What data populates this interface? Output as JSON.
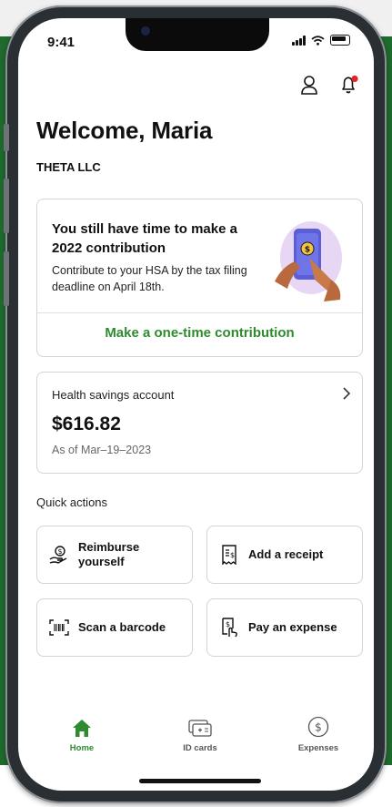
{
  "status_bar": {
    "time": "9:41"
  },
  "header": {
    "greeting": "Welcome, Maria",
    "company": "THETA LLC"
  },
  "promo": {
    "title": "You still have time to make a 2022 contribution",
    "text": "Contribute to your HSA by the tax filing deadline on April 18th.",
    "link": "Make a one-time contribution"
  },
  "account": {
    "label": "Health savings account",
    "amount": "$616.82",
    "as_of": "As of Mar–19–2023"
  },
  "quick_actions": {
    "title": "Quick actions",
    "items": [
      {
        "label": "Reimburse yourself",
        "icon": "reimburse-hand-coin-icon"
      },
      {
        "label": "Add a receipt",
        "icon": "receipt-icon"
      },
      {
        "label": "Scan a barcode",
        "icon": "barcode-scan-icon"
      },
      {
        "label": "Pay an expense",
        "icon": "pay-expense-icon"
      }
    ]
  },
  "tabs": [
    {
      "label": "Home",
      "icon": "home-icon",
      "active": true
    },
    {
      "label": "ID cards",
      "icon": "id-card-icon",
      "active": false
    },
    {
      "label": "Expenses",
      "icon": "dollar-circle-icon",
      "active": false
    }
  ],
  "colors": {
    "accent": "#2e8b2e",
    "background_green": "#1f6b2e",
    "notification_dot": "#e0242b"
  }
}
